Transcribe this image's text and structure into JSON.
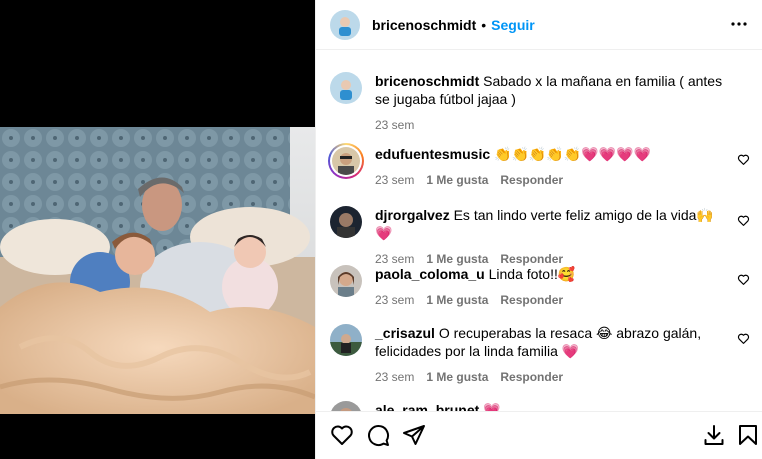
{
  "post": {
    "author": "bricenoschmidt",
    "separator": "•",
    "follow_label": "Seguir"
  },
  "caption": {
    "author": "bricenoschmidt",
    "text": "Sabado x la mañana en familia ( antes se jugaba fútbol jajaa )",
    "time": "23 sem"
  },
  "comments": [
    {
      "user": "edufuentesmusic",
      "text": "👏👏👏👏👏💗💗💗💗",
      "time": "23 sem",
      "likes": "1 Me gusta",
      "reply": "Responder"
    },
    {
      "user": "djrorgalvez",
      "text": "Es tan lindo verte feliz amigo de la vida🙌 💗",
      "time": "23 sem",
      "likes": "1 Me gusta",
      "reply": "Responder"
    },
    {
      "user": "paola_coloma_u",
      "text": "Linda foto!!🥰",
      "time": "23 sem",
      "likes": "1 Me gusta",
      "reply": "Responder"
    },
    {
      "user": "_crisazul",
      "text": "O recuperabas la resaca 😂 abrazo galán, felicidades por la linda familia 💗",
      "time": "23 sem",
      "likes": "1 Me gusta",
      "reply": "Responder"
    },
    {
      "user": "ale_ram_brunet",
      "text": "💗"
    }
  ],
  "icons": {
    "more": "more-options-icon",
    "like": "heart-icon",
    "comment": "comment-icon",
    "share": "share-icon",
    "download": "download-icon",
    "save": "bookmark-icon"
  }
}
